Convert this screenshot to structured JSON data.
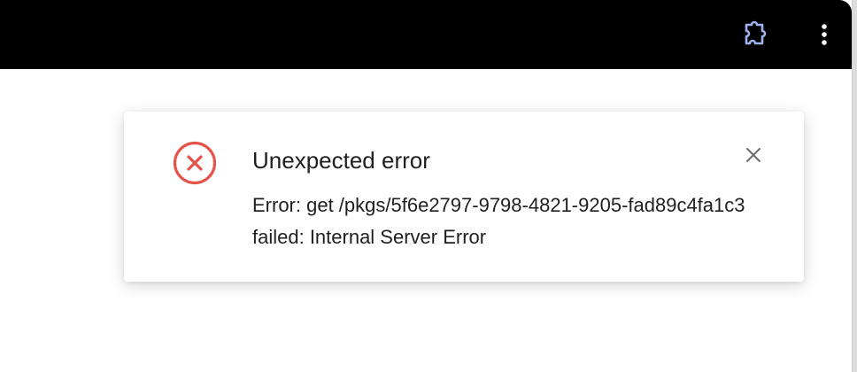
{
  "toolbar": {
    "extensions_icon": "puzzle-piece-icon",
    "menu_icon": "vertical-dots-icon"
  },
  "notification": {
    "type": "error",
    "icon": "error-circle-x-icon",
    "title": "Unexpected error",
    "message": "Error: get /pkgs/5f6e2797-9798-4821-9205-fad89c4fa1c3 failed: Internal Server Error",
    "close_icon": "close-icon"
  },
  "colors": {
    "toolbar_bg": "#000000",
    "error_red": "#e5534b",
    "extension_icon_blue": "#9fb4ef",
    "text": "#1f1f1f",
    "close_gray": "#6b6b6b"
  }
}
